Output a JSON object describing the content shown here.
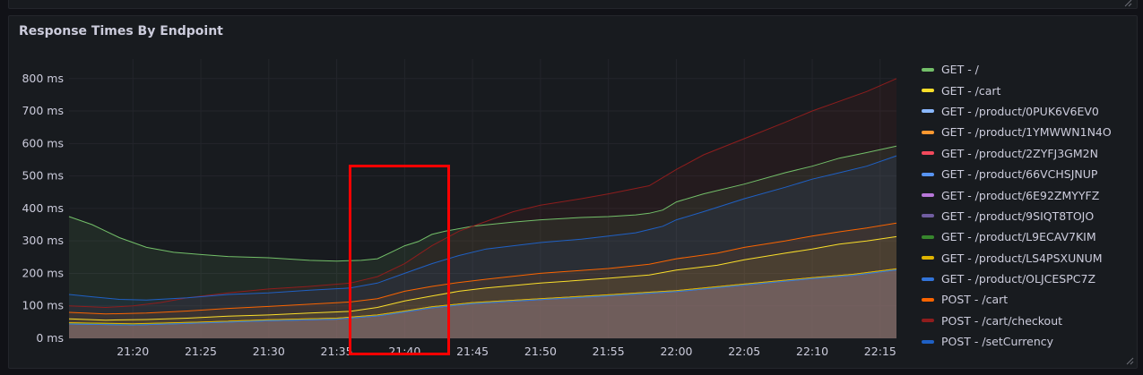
{
  "panel": {
    "title": "Response Times By Endpoint"
  },
  "chart_data": {
    "type": "area",
    "title": "Response Times By Endpoint",
    "xlabel": "",
    "ylabel": "",
    "x_ticks": [
      "21:20",
      "21:25",
      "21:30",
      "21:35",
      "21:40",
      "21:45",
      "21:50",
      "21:55",
      "22:00",
      "22:05",
      "22:10",
      "22:15"
    ],
    "x_tick_minutes": [
      20,
      25,
      30,
      35,
      40,
      45,
      50,
      55,
      60,
      65,
      70,
      75
    ],
    "xlim_minutes": [
      15.3,
      76.2
    ],
    "y_ticks": [
      "0 ms",
      "100 ms",
      "200 ms",
      "300 ms",
      "400 ms",
      "500 ms",
      "600 ms",
      "700 ms",
      "800 ms"
    ],
    "ylim": [
      0,
      860
    ],
    "legend_position": "right",
    "series": [
      {
        "name": "GET - /",
        "color": "#73bf69",
        "x": [
          15.3,
          17,
          19,
          21,
          23,
          25,
          27,
          30,
          33,
          35,
          36.8,
          38,
          39,
          40,
          41,
          42,
          43,
          45,
          48,
          50,
          53,
          55,
          57,
          58,
          59,
          60,
          62,
          65,
          68,
          70,
          72,
          74,
          76.2
        ],
        "y": [
          375,
          350,
          310,
          280,
          265,
          258,
          252,
          248,
          240,
          238,
          240,
          245,
          265,
          285,
          298,
          320,
          330,
          345,
          358,
          365,
          372,
          375,
          380,
          385,
          395,
          420,
          445,
          475,
          510,
          530,
          555,
          572,
          592
        ]
      },
      {
        "name": "GET - /cart",
        "color": "#fade2a",
        "x": [
          15.3,
          18,
          21,
          24,
          27,
          30,
          33,
          36,
          38,
          40,
          42,
          44,
          46,
          50,
          55,
          58,
          60,
          63,
          65,
          68,
          70,
          72,
          74,
          76.2
        ],
        "y": [
          60,
          56,
          58,
          62,
          68,
          72,
          78,
          83,
          95,
          115,
          130,
          145,
          155,
          170,
          185,
          195,
          210,
          225,
          242,
          262,
          275,
          290,
          300,
          313
        ]
      },
      {
        "name": "GET - /product/0PUK6V6EV0",
        "color": "#8ab8ff",
        "x": [
          15.3,
          20,
          25,
          30,
          35,
          38,
          40,
          42,
          45,
          50,
          55,
          58,
          60,
          65,
          70,
          73,
          76.2
        ],
        "y": [
          45,
          42,
          48,
          55,
          60,
          70,
          82,
          95,
          108,
          120,
          132,
          140,
          145,
          165,
          185,
          195,
          212
        ]
      },
      {
        "name": "GET - /product/1YMWWN1N4O",
        "color": "#ff9830",
        "x": [
          15.3,
          20,
          25,
          30,
          35,
          38,
          40,
          42,
          45,
          50,
          55,
          58,
          60,
          65,
          70,
          73,
          76.2
        ],
        "y": [
          48,
          44,
          50,
          57,
          62,
          72,
          84,
          97,
          110,
          122,
          134,
          142,
          147,
          167,
          187,
          197,
          214
        ]
      },
      {
        "name": "GET - /product/2ZYFJ3GM2N",
        "color": "#f2495c",
        "x": [
          15.3,
          20,
          25,
          30,
          35,
          38,
          40,
          42,
          45,
          50,
          55,
          58,
          60,
          65,
          70,
          73,
          76.2
        ],
        "y": [
          46,
          43,
          49,
          56,
          61,
          71,
          83,
          96,
          109,
          121,
          133,
          141,
          146,
          166,
          186,
          196,
          213
        ]
      },
      {
        "name": "GET - /product/66VCHSJNUP",
        "color": "#5794f2",
        "x": [
          15.3,
          20,
          25,
          30,
          35,
          38,
          40,
          42,
          45,
          50,
          55,
          58,
          60,
          65,
          70,
          73,
          76.2
        ],
        "y": [
          44,
          41,
          47,
          54,
          59,
          69,
          81,
          94,
          107,
          119,
          131,
          139,
          144,
          164,
          184,
          194,
          211
        ]
      },
      {
        "name": "GET - /product/6E92ZMYYFZ",
        "color": "#b877d9",
        "x": [
          15.3,
          20,
          25,
          30,
          35,
          38,
          40,
          42,
          45,
          50,
          55,
          58,
          60,
          65,
          70,
          73,
          76.2
        ],
        "y": [
          47,
          44,
          49,
          56,
          61,
          71,
          83,
          96,
          109,
          121,
          133,
          141,
          146,
          166,
          186,
          196,
          213
        ]
      },
      {
        "name": "GET - /product/9SIQT8TOJO",
        "color": "#705da0",
        "x": [
          15.3,
          20,
          25,
          30,
          35,
          38,
          40,
          42,
          45,
          50,
          55,
          58,
          60,
          65,
          70,
          73,
          76.2
        ],
        "y": [
          45,
          42,
          48,
          55,
          60,
          70,
          82,
          95,
          108,
          120,
          132,
          140,
          145,
          165,
          185,
          195,
          212
        ]
      },
      {
        "name": "GET - /product/L9ECAV7KIM",
        "color": "#37872d",
        "x": [
          15.3,
          20,
          25,
          30,
          35,
          38,
          40,
          42,
          45,
          50,
          55,
          58,
          60,
          65,
          70,
          73,
          76.2
        ],
        "y": [
          46,
          43,
          48,
          55,
          60,
          70,
          82,
          95,
          108,
          120,
          132,
          140,
          145,
          165,
          185,
          195,
          212
        ]
      },
      {
        "name": "GET - /product/LS4PSXUNUM",
        "color": "#e0b400",
        "x": [
          15.3,
          20,
          25,
          30,
          35,
          38,
          40,
          42,
          45,
          50,
          55,
          58,
          60,
          65,
          70,
          73,
          76.2
        ],
        "y": [
          48,
          45,
          50,
          57,
          62,
          72,
          84,
          97,
          110,
          122,
          134,
          142,
          147,
          167,
          187,
          197,
          214
        ]
      },
      {
        "name": "GET - /product/OLJCESPC7Z",
        "color": "#3274d9",
        "x": [
          15.3,
          20,
          25,
          30,
          35,
          38,
          40,
          42,
          45,
          50,
          55,
          58,
          60,
          65,
          70,
          73,
          76.2
        ],
        "y": [
          44,
          41,
          47,
          54,
          59,
          69,
          81,
          94,
          107,
          119,
          131,
          139,
          144,
          164,
          184,
          194,
          211
        ]
      },
      {
        "name": "POST - /cart",
        "color": "#fa6400",
        "x": [
          15.3,
          18,
          21,
          24,
          27,
          30,
          33,
          36,
          38,
          40,
          42,
          44,
          46,
          50,
          55,
          58,
          60,
          63,
          65,
          68,
          70,
          72,
          74,
          76.2
        ],
        "y": [
          80,
          75,
          78,
          84,
          92,
          98,
          105,
          112,
          122,
          145,
          160,
          172,
          182,
          200,
          215,
          228,
          245,
          262,
          280,
          300,
          315,
          328,
          340,
          355
        ]
      },
      {
        "name": "POST - /cart/checkout",
        "color": "#8f1d1d",
        "x": [
          15.3,
          18,
          20,
          22,
          24,
          27,
          30,
          33,
          36,
          38,
          40,
          42,
          44,
          46,
          48,
          50,
          53,
          55,
          58,
          60,
          62,
          65,
          68,
          70,
          72,
          74,
          76.2
        ],
        "y": [
          100,
          95,
          100,
          110,
          125,
          140,
          152,
          160,
          170,
          190,
          230,
          285,
          330,
          360,
          390,
          410,
          430,
          445,
          470,
          520,
          565,
          615,
          665,
          700,
          730,
          760,
          800
        ]
      },
      {
        "name": "POST - /setCurrency",
        "color": "#1f60c4",
        "x": [
          15.3,
          17,
          19,
          21,
          24,
          27,
          30,
          33,
          36,
          38,
          40,
          42,
          44,
          46,
          48,
          50,
          53,
          55,
          57,
          58,
          59,
          60,
          62,
          65,
          68,
          70,
          72,
          74,
          76.2
        ],
        "y": [
          135,
          128,
          120,
          118,
          125,
          135,
          140,
          148,
          155,
          170,
          200,
          230,
          255,
          275,
          285,
          295,
          305,
          315,
          325,
          335,
          345,
          365,
          390,
          430,
          465,
          490,
          510,
          530,
          562
        ]
      }
    ]
  }
}
